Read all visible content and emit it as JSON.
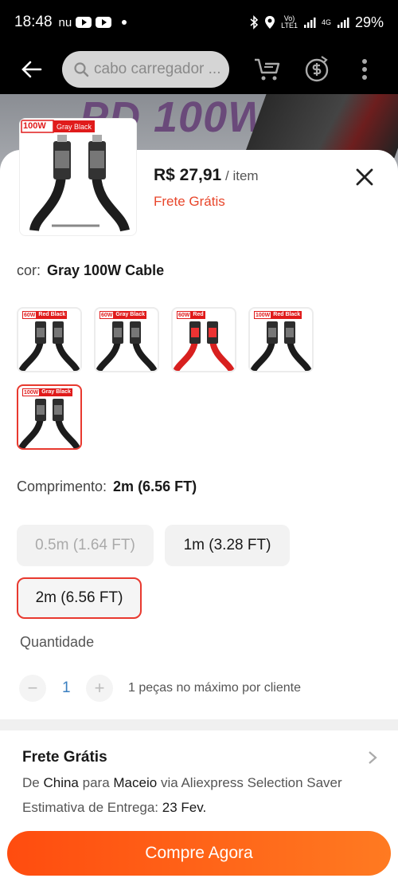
{
  "status_bar": {
    "time": "18:48",
    "notif_text": "nu",
    "signal_a": "Vo)\nLTE1",
    "signal_b": "4G",
    "battery": "29%"
  },
  "header": {
    "search_placeholder": "cabo carregador ...",
    "icons": [
      "back-arrow-icon",
      "search-icon",
      "cart-icon",
      "coin-icon",
      "more-icon"
    ]
  },
  "banner": {
    "text": "PD 100W"
  },
  "product": {
    "thumb_watt": "100W",
    "thumb_color": "Gray Black",
    "price": "R$ 27,91",
    "price_unit": "/ item",
    "shipping": "Frete Grátis"
  },
  "color": {
    "label": "cor:",
    "value": "Gray 100W Cable",
    "options": [
      {
        "watt": "60W",
        "color": "Red Black",
        "cable": "black",
        "selected": false
      },
      {
        "watt": "60W",
        "color": "Gray Black",
        "cable": "black",
        "selected": false
      },
      {
        "watt": "60W",
        "color": "Red",
        "cable": "red",
        "selected": false
      },
      {
        "watt": "100W",
        "color": "Red Black",
        "cable": "black",
        "selected": false
      },
      {
        "watt": "100W",
        "color": "Gray Black",
        "cable": "black",
        "selected": true
      }
    ]
  },
  "length": {
    "label": "Comprimento:",
    "value": "2m (6.56 FT)",
    "options": [
      {
        "label": "0.5m (1.64 FT)",
        "state": "disabled"
      },
      {
        "label": "1m (3.28 FT)",
        "state": "normal"
      },
      {
        "label": "2m (6.56 FT)",
        "state": "selected"
      }
    ]
  },
  "quantity": {
    "label": "Quantidade",
    "minus": "−",
    "value": "1",
    "plus": "+",
    "note": "1 peças no máximo por cliente"
  },
  "shipping_info": {
    "title": "Frete Grátis",
    "de": "De",
    "origin": "China",
    "para": "para",
    "destination": "Maceio",
    "via": "via Aliexpress Selection Saver",
    "estimate_label": "Estimativa de Entrega:",
    "estimate_date": "23 Fev."
  },
  "buy_button": "Compre Agora"
}
